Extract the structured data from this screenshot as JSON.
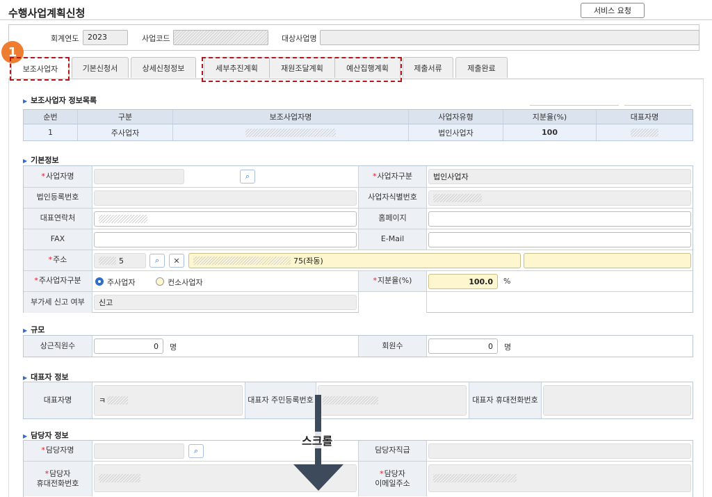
{
  "page": {
    "title": "수행사업계획신청",
    "service_button": "서비스 요청"
  },
  "search": {
    "fiscal_year_label": "회계연도",
    "fiscal_year_value": "2023",
    "project_code_label": "사업코드",
    "target_project_label": "대상사업명"
  },
  "badge": "1",
  "tabs": [
    "보조사업자",
    "기본신청서",
    "상세신청정보",
    "세부추진계획",
    "재원조달계획",
    "예산집행계획",
    "제출서류",
    "제출완료"
  ],
  "subsidy_list": {
    "title": "보조사업자 정보목록",
    "columns": [
      "순번",
      "구분",
      "보조사업자명",
      "사업자유형",
      "지분율(%)",
      "대표자명"
    ],
    "rows": [
      [
        "1",
        "주사업자",
        "",
        "법인사업자",
        "100",
        ""
      ]
    ]
  },
  "basic": {
    "title": "기본정보",
    "business_name_label": "사업자명",
    "business_type_label": "사업자구분",
    "business_type_value": "법인사업자",
    "corp_reg_label": "법인등록번호",
    "business_id_label": "사업자식별번호",
    "contact_label": "대표연락처",
    "homepage_label": "홈페이지",
    "fax_label": "FAX",
    "email_label": "E-Mail",
    "address_label": "주소",
    "zip_value": "5",
    "address_value": "75(좌동)",
    "main_type_label": "주사업자구분",
    "radio_main": "주사업자",
    "radio_consortium": "컨소사업자",
    "share_label": "지분율(%)",
    "share_value": "100.0",
    "share_unit": "%",
    "vat_label": "부가세 신고 여부",
    "vat_value": "신고"
  },
  "scale": {
    "title": "규모",
    "fulltime_label": "상근직원수",
    "fulltime_value": "0",
    "fulltime_unit": "명",
    "members_label": "회원수",
    "members_value": "0",
    "members_unit": "명"
  },
  "rep": {
    "title": "대표자 정보",
    "name_label": "대표자명",
    "name_value": "ㅋ",
    "rrn_label": "대표자 주민등록번호",
    "mobile_label": "대표자 휴대전화번호"
  },
  "manager": {
    "title": "담당자 정보",
    "name_label": "담당자명",
    "position_label": "담당자직급",
    "mobile_label_1": "담당자",
    "mobile_label_2": "휴대전화번호",
    "email_label_1": "담당자",
    "email_label_2": "이메일주소"
  },
  "scroll_hint": "스크롤",
  "colors": {
    "accent": "#2f6fcb",
    "highlight": "#b3171a",
    "badge": "#ee7d31",
    "required": "#e0222a"
  },
  "icons": {
    "search": "search-icon",
    "clear": "close-icon"
  }
}
